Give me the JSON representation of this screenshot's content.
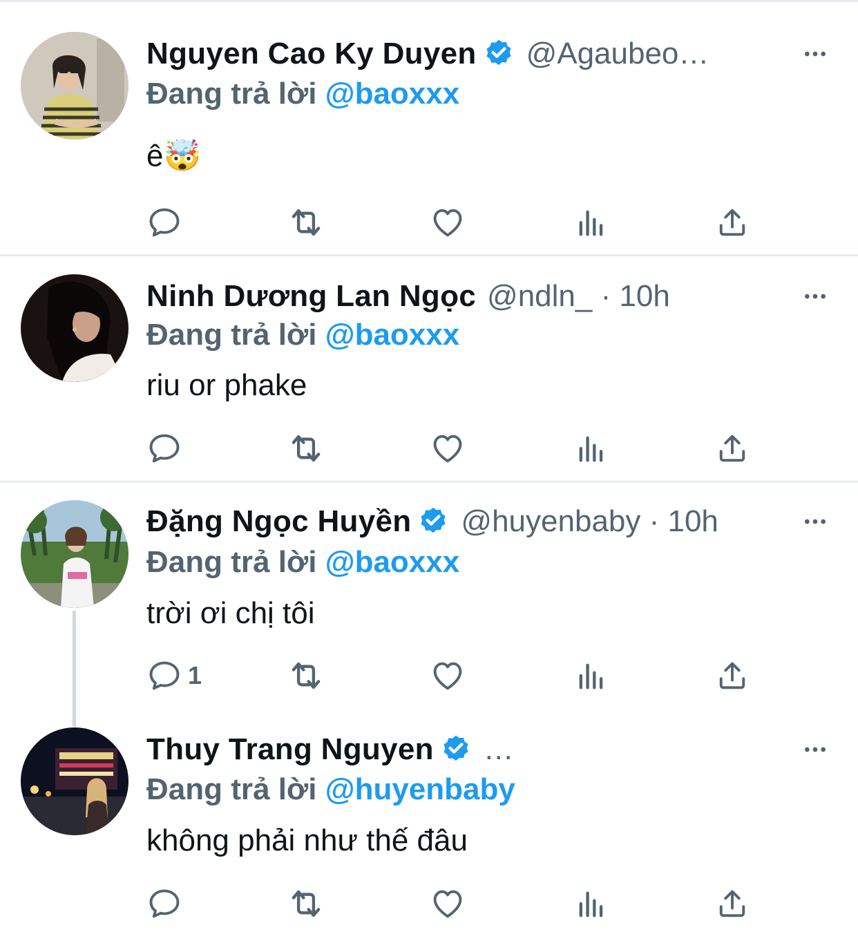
{
  "tweets": [
    {
      "name": "Nguyen Cao Ky Duyen",
      "verified": true,
      "handle": "@Agaubeo…",
      "reply_prefix": "Đang trả lời",
      "reply_to": "@baoxxx",
      "text": "ê🤯",
      "reply_count": ""
    },
    {
      "name": "Ninh Dương Lan Ngọc",
      "verified": false,
      "handle": "@ndln_ · 10h",
      "reply_prefix": "Đang trả lời",
      "reply_to": "@baoxxx",
      "text": "riu or phake",
      "reply_count": ""
    },
    {
      "name": "Đặng Ngọc Huyền",
      "verified": true,
      "handle": "@huyenbaby · 10h",
      "reply_prefix": "Đang trả lời",
      "reply_to": "@baoxxx",
      "text": "trời ơi chị tôi",
      "reply_count": "1"
    },
    {
      "name": "Thuy Trang Nguyen",
      "verified": true,
      "handle": "…",
      "reply_prefix": "Đang trả lời",
      "reply_to": "@huyenbaby",
      "text": "không phải như thế đâu",
      "reply_count": ""
    }
  ],
  "icons": {
    "reply": "reply-icon",
    "retweet": "retweet-icon",
    "like": "heart-icon",
    "views": "views-icon",
    "share": "share-icon",
    "more": "more-icon",
    "verified": "verified-badge-icon"
  },
  "colors": {
    "accent": "#1d9bf0",
    "secondary_text": "#536471",
    "divider": "#e6ecf0",
    "thread_line": "#cfd9de"
  }
}
